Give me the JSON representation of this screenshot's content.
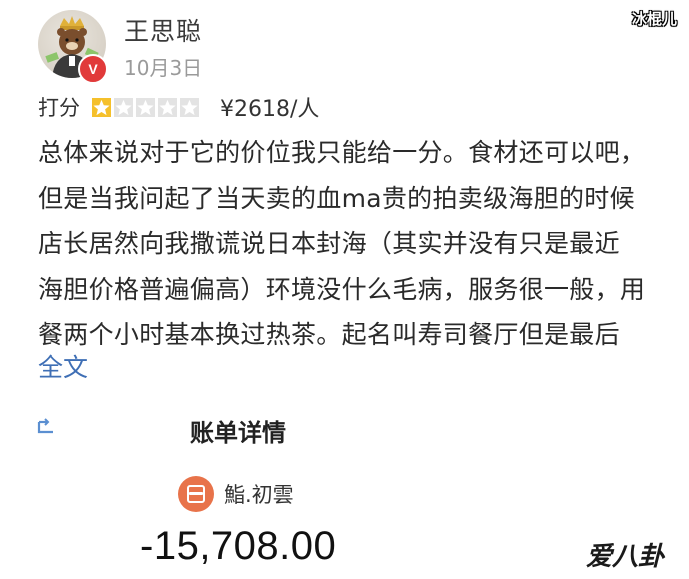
{
  "header": {
    "username": "王思聪",
    "date": "10月3日",
    "badge": "V",
    "watermark_top": "冰棍儿"
  },
  "rating": {
    "label": "打分",
    "stars_filled": 1,
    "stars_total": 5,
    "price": "¥2618/人",
    "star_color": "#f5c02b",
    "star_empty_color": "#e3e3e3"
  },
  "review": {
    "lines": [
      "总体来说对于它的价位我只能给一分。食材还可以吧，",
      "但是当我问起了当天卖的血ma贵的拍卖级海胆的时候",
      "店长居然向我撒谎说日本封海（其实并没有只是最近",
      "海胆价格普遍偏高）环境没什么毛病，服务很一般，用",
      "餐两个小时基本换过热茶。起名叫寿司餐厅但是最后"
    ],
    "full_text_label": "全文",
    "link_color": "#3f6fb5"
  },
  "bill": {
    "title": "账单详情",
    "merchant_name": "鮨.初雲",
    "merchant_icon": "restaurant-icon",
    "merchant_color": "#e8734a",
    "amount": "-15,708.00",
    "back_icon": "back-icon"
  },
  "watermark_bottom": "爱八卦"
}
